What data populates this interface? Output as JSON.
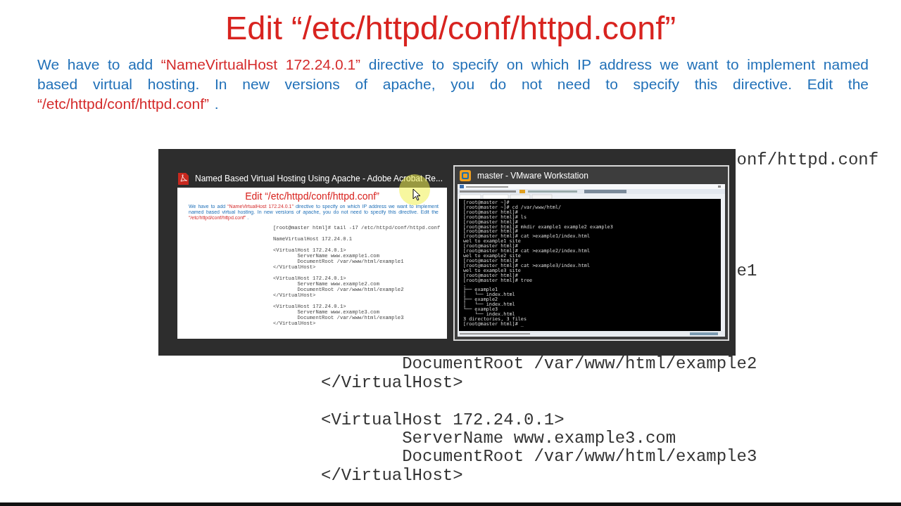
{
  "title": "Edit “/etc/httpd/conf/httpd.conf”",
  "paragraph": [
    {
      "text": "We have to add ",
      "kind": "plain"
    },
    {
      "text": "“NameVirtualHost 172.24.0.1”",
      "kind": "quote"
    },
    {
      "text": " directive to specify on which IP address we want to implement named based virtual hosting. In new versions of apache, you do not need to specify this directive. Edit the ",
      "kind": "plain"
    },
    {
      "text": "“/etc/httpd/conf/httpd.conf”",
      "kind": "quote"
    },
    {
      "text": " .",
      "kind": "plain"
    }
  ],
  "code": {
    "command": "onf/httpd.conf",
    "blocks": [
      {
        "children": [
          "e1"
        ]
      },
      {
        "children": [
          "DocumentRoot /var/www/html/example2"
        ],
        "close": "</VirtualHost>"
      },
      {
        "open": "<VirtualHost 172.24.0.1>",
        "children": [
          "ServerName www.example3.com",
          "DocumentRoot /var/www/html/example3"
        ],
        "close": "</VirtualHost>"
      }
    ]
  },
  "thumbnails": [
    {
      "kind": "pdf",
      "title": "Named Based Virtual Hosting Using Apache - Adobe Acrobat Re...",
      "selected": false,
      "slide": {
        "title": "Edit “/etc/httpd/conf/httpd.conf”",
        "paragraph": [
          {
            "text": "We have to add ",
            "kind": "plain"
          },
          {
            "text": "“NameVirtualHost 172.24.0.1”",
            "kind": "quote"
          },
          {
            "text": " directive to specify on which IP address we want to implement named based virtual hosting. In new versions of apache, you do not need to specify this directive. Edit the ",
            "kind": "plain"
          },
          {
            "text": "“/etc/httpd/conf/httpd.conf”",
            "kind": "quote"
          },
          {
            "text": " .",
            "kind": "plain"
          }
        ],
        "code": {
          "command": "[root@master html]# tail -17 /etc/httpd/conf/httpd.conf",
          "directive": "NameVirtualHost 172.24.0.1",
          "blocks": [
            {
              "open": "<VirtualHost 172.24.0.1>",
              "children": [
                "ServerName www.example1.com",
                "DocumentRoot /var/www/html/example1"
              ],
              "close": "</VirtualHost>"
            },
            {
              "open": "<VirtualHost 172.24.0.1>",
              "children": [
                "ServerName www.example2.com",
                "DocumentRoot /var/www/html/example2"
              ],
              "close": "</VirtualHost>"
            },
            {
              "open": "<VirtualHost 172.24.0.1>",
              "children": [
                "ServerName www.example3.com",
                "DocumentRoot /var/www/html/example3"
              ],
              "close": "</VirtualHost>"
            }
          ]
        }
      }
    },
    {
      "kind": "vm",
      "title": "master - VMware Workstation",
      "selected": true,
      "terminal": [
        "[root@master ~]#",
        "[root@master ~]# cd /var/www/html/",
        "[root@master html]#",
        "[root@master html]# ls",
        "[root@master html]#",
        "[root@master html]# mkdir example1 example2 example3",
        "[root@master html]#",
        "[root@master html]# cat >example1/index.html",
        "wel to example1 site",
        "[root@master html]#",
        "[root@master html]# cat >example2/index.html",
        "wel to example2 site",
        "[root@master html]#",
        "[root@master html]# cat >example3/index.html",
        "wel to example3 site",
        "[root@master html]#",
        "[root@master html]# tree",
        ".",
        "├── example1",
        "│   └── index.html",
        "├── example2",
        "│   └── index.html",
        "└── example3",
        "    └── index.html",
        "3 directories, 3 files",
        "[root@master html]# _"
      ]
    }
  ]
}
